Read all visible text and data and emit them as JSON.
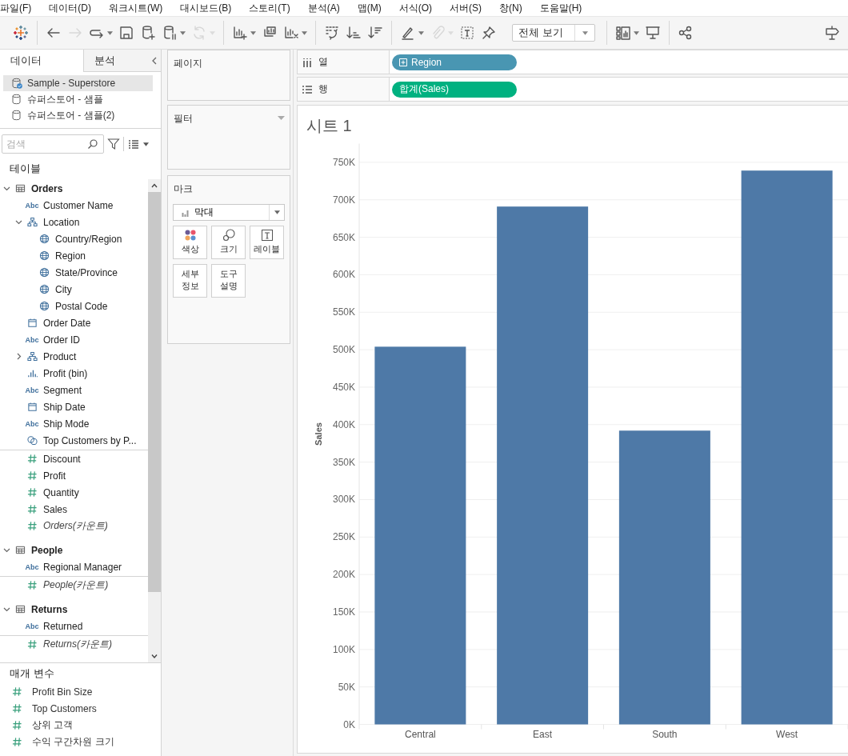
{
  "menu": [
    "파일(F)",
    "데이터(D)",
    "워크시트(W)",
    "대시보드(B)",
    "스토리(T)",
    "분석(A)",
    "맵(M)",
    "서식(O)",
    "서버(S)",
    "창(N)",
    "도움말(H)"
  ],
  "toolbar": {
    "groups": [
      [
        {
          "kind": "logo",
          "disabled": false,
          "caret": false
        }
      ],
      [
        {
          "kind": "back",
          "disabled": false,
          "caret": false
        },
        {
          "kind": "forward",
          "disabled": true,
          "caret": false
        },
        {
          "kind": "loop",
          "disabled": false,
          "caret": true
        },
        {
          "kind": "save",
          "disabled": false,
          "caret": false
        },
        {
          "kind": "add-source",
          "disabled": false,
          "caret": false
        },
        {
          "kind": "pause-source",
          "disabled": false,
          "caret": true
        },
        {
          "kind": "refresh",
          "disabled": true,
          "caret": true
        }
      ],
      [
        {
          "kind": "new-sheet",
          "disabled": false,
          "caret": true
        },
        {
          "kind": "duplicate",
          "disabled": false,
          "caret": false
        },
        {
          "kind": "clear",
          "disabled": false,
          "caret": true
        }
      ],
      [
        {
          "kind": "swap",
          "disabled": false,
          "caret": false
        },
        {
          "kind": "sort-asc",
          "disabled": false,
          "caret": false
        },
        {
          "kind": "sort-desc",
          "disabled": false,
          "caret": false
        }
      ],
      [
        {
          "kind": "highlight",
          "disabled": false,
          "caret": true
        },
        {
          "kind": "paperclip",
          "disabled": true,
          "caret": true
        },
        {
          "kind": "text-box",
          "disabled": false,
          "caret": false
        },
        {
          "kind": "pin",
          "disabled": false,
          "caret": false
        },
        {
          "kind": "dropdown",
          "label": "전체 보기",
          "disabled": false,
          "caret": true
        }
      ],
      [
        {
          "kind": "show-me",
          "disabled": false,
          "caret": true
        },
        {
          "kind": "presentation",
          "disabled": false,
          "caret": false
        }
      ],
      [
        {
          "kind": "share",
          "disabled": false,
          "caret": false
        }
      ],
      [
        {
          "kind": "signpost",
          "disabled": false,
          "caret": false
        }
      ]
    ]
  },
  "left_panel": {
    "tabs": [
      {
        "label": "데이터",
        "selected": true
      },
      {
        "label": "분석",
        "selected": false
      }
    ],
    "data_sources": [
      {
        "name": "Sample - Superstore",
        "kind": "primary",
        "selected": true
      },
      {
        "name": "슈퍼스토어 - 샘플",
        "kind": "secondary",
        "selected": false
      },
      {
        "name": "슈퍼스토어 - 샘플(2)",
        "kind": "secondary",
        "selected": false
      }
    ],
    "search": {
      "placeholder": "검색"
    },
    "tables_heading": "테이블",
    "tables": [
      {
        "name": "Orders",
        "kind": "table",
        "expanded": true,
        "children": [
          {
            "name": "Customer Name",
            "kind": "text",
            "icon_text": "Abc"
          },
          {
            "name": "Location",
            "kind": "hierarchy",
            "expanded": true,
            "children": [
              {
                "name": "Country/Region",
                "kind": "geo"
              },
              {
                "name": "Region",
                "kind": "geo"
              },
              {
                "name": "State/Province",
                "kind": "geo"
              },
              {
                "name": "City",
                "kind": "geo"
              },
              {
                "name": "Postal Code",
                "kind": "geo"
              }
            ]
          },
          {
            "name": "Order Date",
            "kind": "date"
          },
          {
            "name": "Order ID",
            "kind": "text",
            "icon_text": "Abc"
          },
          {
            "name": "Product",
            "kind": "hierarchy",
            "expanded": false
          },
          {
            "name": "Profit (bin)",
            "kind": "bin"
          },
          {
            "name": "Segment",
            "kind": "text",
            "icon_text": "Abc"
          },
          {
            "name": "Ship Date",
            "kind": "date"
          },
          {
            "name": "Ship Mode",
            "kind": "text",
            "icon_text": "Abc"
          },
          {
            "name": "Top Customers by P...",
            "kind": "set"
          },
          {
            "name": "Discount",
            "kind": "measure"
          },
          {
            "name": "Profit",
            "kind": "measure"
          },
          {
            "name": "Quantity",
            "kind": "measure"
          },
          {
            "name": "Sales",
            "kind": "measure"
          },
          {
            "name": "Orders(카운트)",
            "kind": "count"
          }
        ]
      },
      {
        "name": "People",
        "kind": "table",
        "expanded": true,
        "children": [
          {
            "name": "Regional Manager",
            "kind": "text",
            "icon_text": "Abc"
          },
          {
            "name": "People(카운트)",
            "kind": "count"
          }
        ]
      },
      {
        "name": "Returns",
        "kind": "table",
        "expanded": true,
        "children": [
          {
            "name": "Returned",
            "kind": "text",
            "icon_text": "Abc"
          },
          {
            "name": "Returns(카운트)",
            "kind": "count"
          }
        ]
      }
    ],
    "parameters": {
      "heading": "매개 변수",
      "items": [
        {
          "name": "Profit Bin Size",
          "kind": "measure"
        },
        {
          "name": "Top Customers",
          "kind": "measure"
        },
        {
          "name": "상위 고객",
          "kind": "measure"
        },
        {
          "name": "수익 구간차원 크기",
          "kind": "measure"
        }
      ]
    }
  },
  "cards": {
    "pages": "페이지",
    "filters": "필터",
    "marks": {
      "title": "마크",
      "mark_type": "막대",
      "buttons": [
        {
          "label": "색상",
          "kind": "color"
        },
        {
          "label": "크기",
          "kind": "size"
        },
        {
          "label": "레이블",
          "kind": "label"
        },
        {
          "label": "세부 정보",
          "kind": "detail"
        },
        {
          "label": "도구 설명",
          "kind": "tooltip"
        }
      ]
    }
  },
  "shelves": [
    {
      "label": "열",
      "kind": "columns",
      "pill": {
        "label": "Region",
        "kind": "dimension"
      }
    },
    {
      "label": "행",
      "kind": "rows",
      "pill": {
        "label": "합계(Sales)",
        "kind": "measure"
      }
    }
  ],
  "sheet": {
    "title": "시트 1",
    "chart_data": {
      "type": "bar",
      "ylabel": "Sales",
      "categories": [
        "Central",
        "East",
        "South",
        "West"
      ],
      "series": [
        {
          "color": "#4e79a7",
          "values": [
            504000,
            691000,
            392000,
            739000
          ]
        }
      ],
      "grid": true,
      "ylim": [
        0,
        775000
      ],
      "yticks": [
        {
          "value": 0,
          "label": "0K"
        },
        {
          "value": 50000,
          "label": "50K"
        },
        {
          "value": 100000,
          "label": "100K"
        },
        {
          "value": 150000,
          "label": "150K"
        },
        {
          "value": 200000,
          "label": "200K"
        },
        {
          "value": 250000,
          "label": "250K"
        },
        {
          "value": 300000,
          "label": "300K"
        },
        {
          "value": 350000,
          "label": "350K"
        },
        {
          "value": 400000,
          "label": "400K"
        },
        {
          "value": 450000,
          "label": "450K"
        },
        {
          "value": 500000,
          "label": "500K"
        },
        {
          "value": 550000,
          "label": "550K"
        },
        {
          "value": 600000,
          "label": "600K"
        },
        {
          "value": 650000,
          "label": "650K"
        },
        {
          "value": 700000,
          "label": "700K"
        },
        {
          "value": 750000,
          "label": "750K"
        }
      ]
    }
  }
}
